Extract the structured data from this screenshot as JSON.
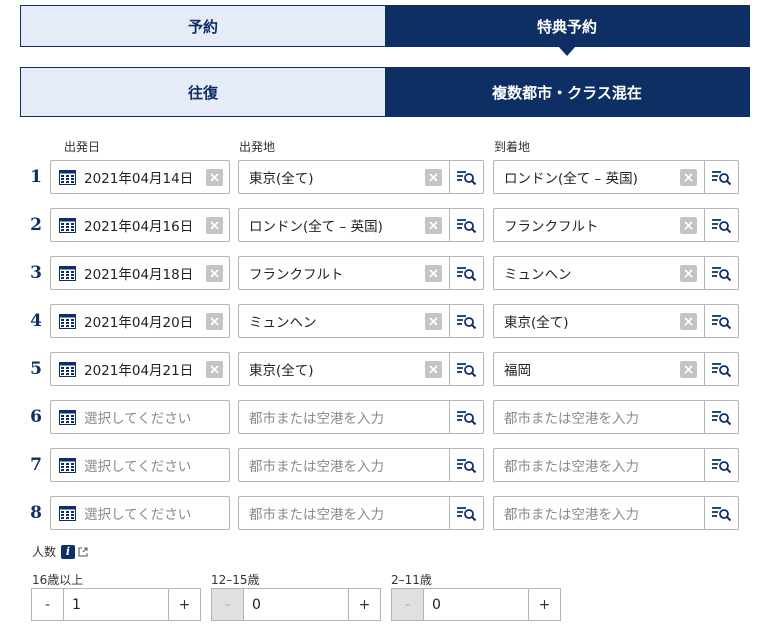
{
  "tabs_top": {
    "reservation": "予約",
    "award": "特典予約"
  },
  "tabs_sub": {
    "roundtrip": "往復",
    "multicity": "複数都市・クラス混在"
  },
  "labels": {
    "departure_date": "出発日",
    "origin": "出発地",
    "destination": "到着地"
  },
  "rows": [
    {
      "num": "1",
      "date": "2021年04月14日",
      "from": "東京(全て)",
      "to": "ロンドン(全て – 英国)"
    },
    {
      "num": "2",
      "date": "2021年04月16日",
      "from": "ロンドン(全て – 英国)",
      "to": "フランクフルト"
    },
    {
      "num": "3",
      "date": "2021年04月18日",
      "from": "フランクフルト",
      "to": "ミュンヘン"
    },
    {
      "num": "4",
      "date": "2021年04月20日",
      "from": "ミュンヘン",
      "to": "東京(全て)"
    },
    {
      "num": "5",
      "date": "2021年04月21日",
      "from": "東京(全て)",
      "to": "福岡"
    },
    {
      "num": "6",
      "date": "",
      "from": "",
      "to": ""
    },
    {
      "num": "7",
      "date": "",
      "from": "",
      "to": ""
    },
    {
      "num": "8",
      "date": "",
      "from": "",
      "to": ""
    }
  ],
  "placeholders": {
    "date": "選択してください",
    "city": "都市または空港を入力"
  },
  "passengers": {
    "label": "人数",
    "groups": [
      {
        "label": "16歳以上",
        "value": "1",
        "minus": "-",
        "plus": "+"
      },
      {
        "label": "12–15歳",
        "value": "0",
        "minus": "-",
        "plus": "+"
      },
      {
        "label": "2–11歳",
        "value": "0",
        "minus": "-",
        "plus": "+"
      }
    ]
  },
  "colors": {
    "navy": "#0d2f63",
    "light_tab": "#e6ecf7"
  }
}
